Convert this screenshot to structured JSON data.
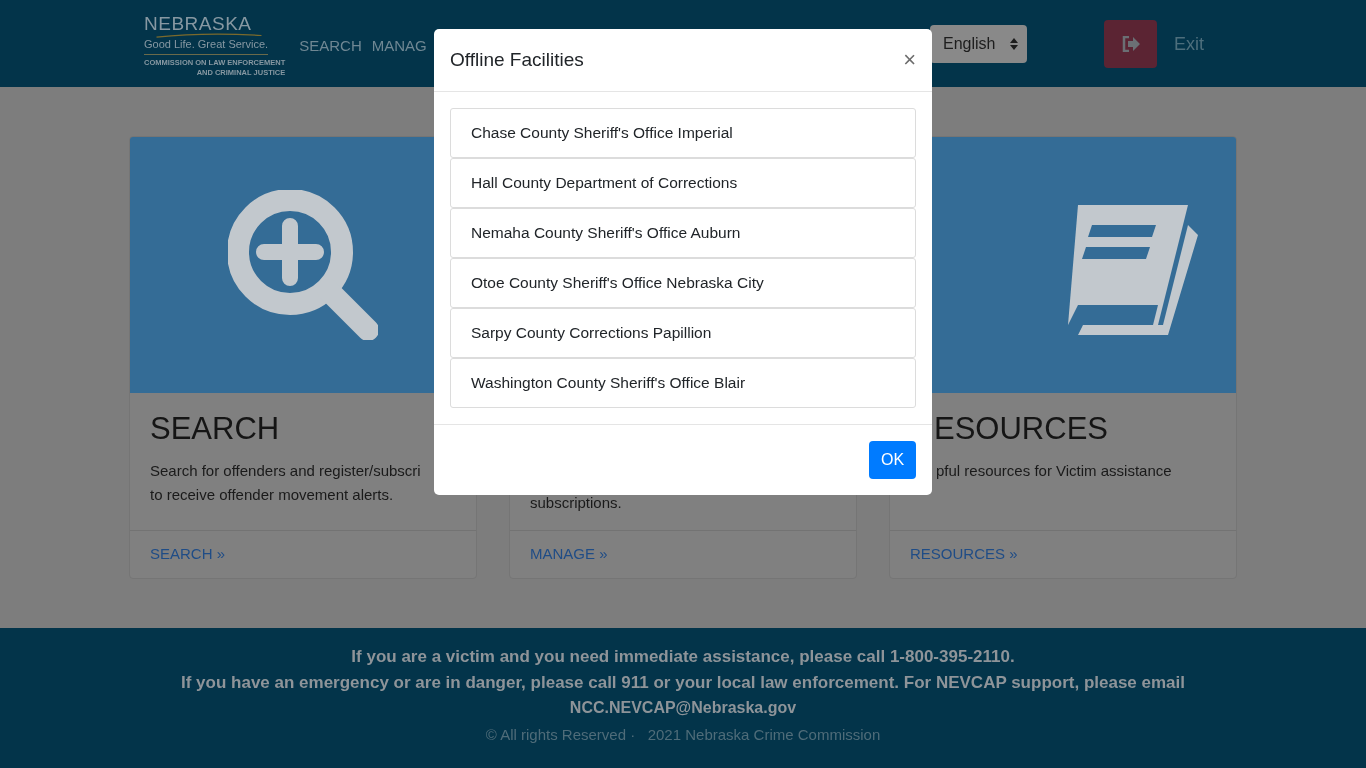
{
  "header": {
    "logo": {
      "name": "NEBRASKA",
      "tagline": "Good Life. Great Service.",
      "agency_lines": [
        "COMMISSION ON LAW ENFORCEMENT",
        "AND CRIMINAL JUSTICE"
      ]
    },
    "nav": [
      "SEARCH",
      "MANAG"
    ],
    "language": {
      "value": "English"
    },
    "exit": {
      "label": "Exit"
    }
  },
  "cards": [
    {
      "kind": "search",
      "title": "SEARCH",
      "description_lines": [
        "Search for offenders and register/subscri",
        "to receive offender movement alerts."
      ],
      "link": "SEARCH »"
    },
    {
      "kind": "manage",
      "description_lines": [
        "subscriptions."
      ],
      "link": "MANAGE »"
    },
    {
      "kind": "resources",
      "title": "ESOURCES",
      "description_lines": [
        "pful resources for Victim assistance"
      ],
      "link": "RESOURCES »"
    }
  ],
  "modal": {
    "title": "Offline Facilities",
    "close": "×",
    "items": [
      "Chase County Sheriff's Office Imperial",
      "Hall County Department of Corrections",
      "Nemaha County Sheriff's Office Auburn",
      "Otoe County Sheriff's Office Nebraska City",
      "Sarpy County Corrections Papillion",
      "Washington County Sheriff's Office Blair"
    ],
    "ok": "OK"
  },
  "footer": {
    "lines": [
      "If you are a victim and you need immediate assistance, please call 1-800-395-2110.",
      "If you have an emergency or are in danger, please call 911 or your local law enforcement. For NEVCAP support, please email"
    ],
    "email": "NCC.NEVCAP@Nebraska.gov",
    "copyright": "© All rights Reserved ·   2021 Nebraska Crime Commission"
  }
}
